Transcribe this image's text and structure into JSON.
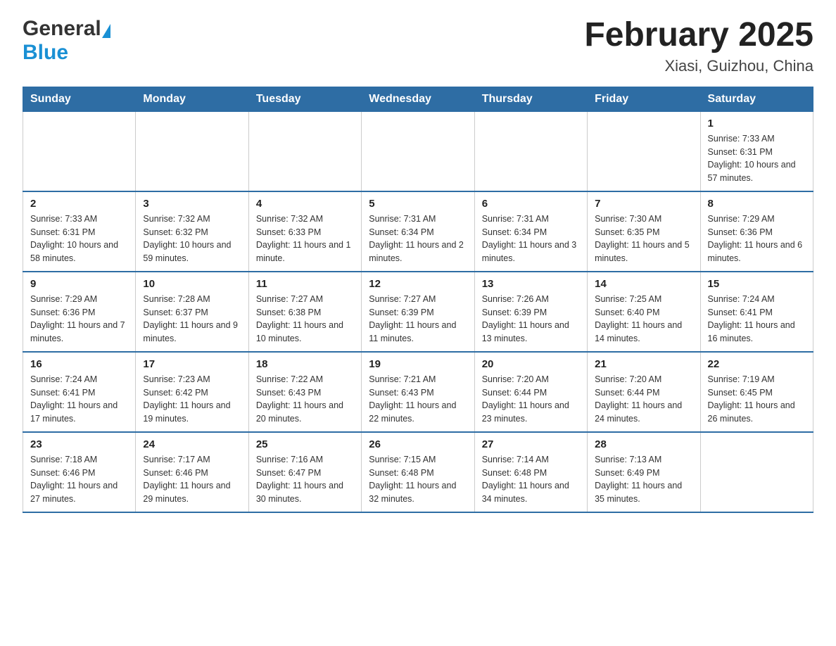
{
  "header": {
    "logo_general": "General",
    "logo_blue": "Blue",
    "month_year": "February 2025",
    "location": "Xiasi, Guizhou, China"
  },
  "days_of_week": [
    "Sunday",
    "Monday",
    "Tuesday",
    "Wednesday",
    "Thursday",
    "Friday",
    "Saturday"
  ],
  "weeks": [
    [
      {
        "day": "",
        "sunrise": "",
        "sunset": "",
        "daylight": ""
      },
      {
        "day": "",
        "sunrise": "",
        "sunset": "",
        "daylight": ""
      },
      {
        "day": "",
        "sunrise": "",
        "sunset": "",
        "daylight": ""
      },
      {
        "day": "",
        "sunrise": "",
        "sunset": "",
        "daylight": ""
      },
      {
        "day": "",
        "sunrise": "",
        "sunset": "",
        "daylight": ""
      },
      {
        "day": "",
        "sunrise": "",
        "sunset": "",
        "daylight": ""
      },
      {
        "day": "1",
        "sunrise": "Sunrise: 7:33 AM",
        "sunset": "Sunset: 6:31 PM",
        "daylight": "Daylight: 10 hours and 57 minutes."
      }
    ],
    [
      {
        "day": "2",
        "sunrise": "Sunrise: 7:33 AM",
        "sunset": "Sunset: 6:31 PM",
        "daylight": "Daylight: 10 hours and 58 minutes."
      },
      {
        "day": "3",
        "sunrise": "Sunrise: 7:32 AM",
        "sunset": "Sunset: 6:32 PM",
        "daylight": "Daylight: 10 hours and 59 minutes."
      },
      {
        "day": "4",
        "sunrise": "Sunrise: 7:32 AM",
        "sunset": "Sunset: 6:33 PM",
        "daylight": "Daylight: 11 hours and 1 minute."
      },
      {
        "day": "5",
        "sunrise": "Sunrise: 7:31 AM",
        "sunset": "Sunset: 6:34 PM",
        "daylight": "Daylight: 11 hours and 2 minutes."
      },
      {
        "day": "6",
        "sunrise": "Sunrise: 7:31 AM",
        "sunset": "Sunset: 6:34 PM",
        "daylight": "Daylight: 11 hours and 3 minutes."
      },
      {
        "day": "7",
        "sunrise": "Sunrise: 7:30 AM",
        "sunset": "Sunset: 6:35 PM",
        "daylight": "Daylight: 11 hours and 5 minutes."
      },
      {
        "day": "8",
        "sunrise": "Sunrise: 7:29 AM",
        "sunset": "Sunset: 6:36 PM",
        "daylight": "Daylight: 11 hours and 6 minutes."
      }
    ],
    [
      {
        "day": "9",
        "sunrise": "Sunrise: 7:29 AM",
        "sunset": "Sunset: 6:36 PM",
        "daylight": "Daylight: 11 hours and 7 minutes."
      },
      {
        "day": "10",
        "sunrise": "Sunrise: 7:28 AM",
        "sunset": "Sunset: 6:37 PM",
        "daylight": "Daylight: 11 hours and 9 minutes."
      },
      {
        "day": "11",
        "sunrise": "Sunrise: 7:27 AM",
        "sunset": "Sunset: 6:38 PM",
        "daylight": "Daylight: 11 hours and 10 minutes."
      },
      {
        "day": "12",
        "sunrise": "Sunrise: 7:27 AM",
        "sunset": "Sunset: 6:39 PM",
        "daylight": "Daylight: 11 hours and 11 minutes."
      },
      {
        "day": "13",
        "sunrise": "Sunrise: 7:26 AM",
        "sunset": "Sunset: 6:39 PM",
        "daylight": "Daylight: 11 hours and 13 minutes."
      },
      {
        "day": "14",
        "sunrise": "Sunrise: 7:25 AM",
        "sunset": "Sunset: 6:40 PM",
        "daylight": "Daylight: 11 hours and 14 minutes."
      },
      {
        "day": "15",
        "sunrise": "Sunrise: 7:24 AM",
        "sunset": "Sunset: 6:41 PM",
        "daylight": "Daylight: 11 hours and 16 minutes."
      }
    ],
    [
      {
        "day": "16",
        "sunrise": "Sunrise: 7:24 AM",
        "sunset": "Sunset: 6:41 PM",
        "daylight": "Daylight: 11 hours and 17 minutes."
      },
      {
        "day": "17",
        "sunrise": "Sunrise: 7:23 AM",
        "sunset": "Sunset: 6:42 PM",
        "daylight": "Daylight: 11 hours and 19 minutes."
      },
      {
        "day": "18",
        "sunrise": "Sunrise: 7:22 AM",
        "sunset": "Sunset: 6:43 PM",
        "daylight": "Daylight: 11 hours and 20 minutes."
      },
      {
        "day": "19",
        "sunrise": "Sunrise: 7:21 AM",
        "sunset": "Sunset: 6:43 PM",
        "daylight": "Daylight: 11 hours and 22 minutes."
      },
      {
        "day": "20",
        "sunrise": "Sunrise: 7:20 AM",
        "sunset": "Sunset: 6:44 PM",
        "daylight": "Daylight: 11 hours and 23 minutes."
      },
      {
        "day": "21",
        "sunrise": "Sunrise: 7:20 AM",
        "sunset": "Sunset: 6:44 PM",
        "daylight": "Daylight: 11 hours and 24 minutes."
      },
      {
        "day": "22",
        "sunrise": "Sunrise: 7:19 AM",
        "sunset": "Sunset: 6:45 PM",
        "daylight": "Daylight: 11 hours and 26 minutes."
      }
    ],
    [
      {
        "day": "23",
        "sunrise": "Sunrise: 7:18 AM",
        "sunset": "Sunset: 6:46 PM",
        "daylight": "Daylight: 11 hours and 27 minutes."
      },
      {
        "day": "24",
        "sunrise": "Sunrise: 7:17 AM",
        "sunset": "Sunset: 6:46 PM",
        "daylight": "Daylight: 11 hours and 29 minutes."
      },
      {
        "day": "25",
        "sunrise": "Sunrise: 7:16 AM",
        "sunset": "Sunset: 6:47 PM",
        "daylight": "Daylight: 11 hours and 30 minutes."
      },
      {
        "day": "26",
        "sunrise": "Sunrise: 7:15 AM",
        "sunset": "Sunset: 6:48 PM",
        "daylight": "Daylight: 11 hours and 32 minutes."
      },
      {
        "day": "27",
        "sunrise": "Sunrise: 7:14 AM",
        "sunset": "Sunset: 6:48 PM",
        "daylight": "Daylight: 11 hours and 34 minutes."
      },
      {
        "day": "28",
        "sunrise": "Sunrise: 7:13 AM",
        "sunset": "Sunset: 6:49 PM",
        "daylight": "Daylight: 11 hours and 35 minutes."
      },
      {
        "day": "",
        "sunrise": "",
        "sunset": "",
        "daylight": ""
      }
    ]
  ]
}
